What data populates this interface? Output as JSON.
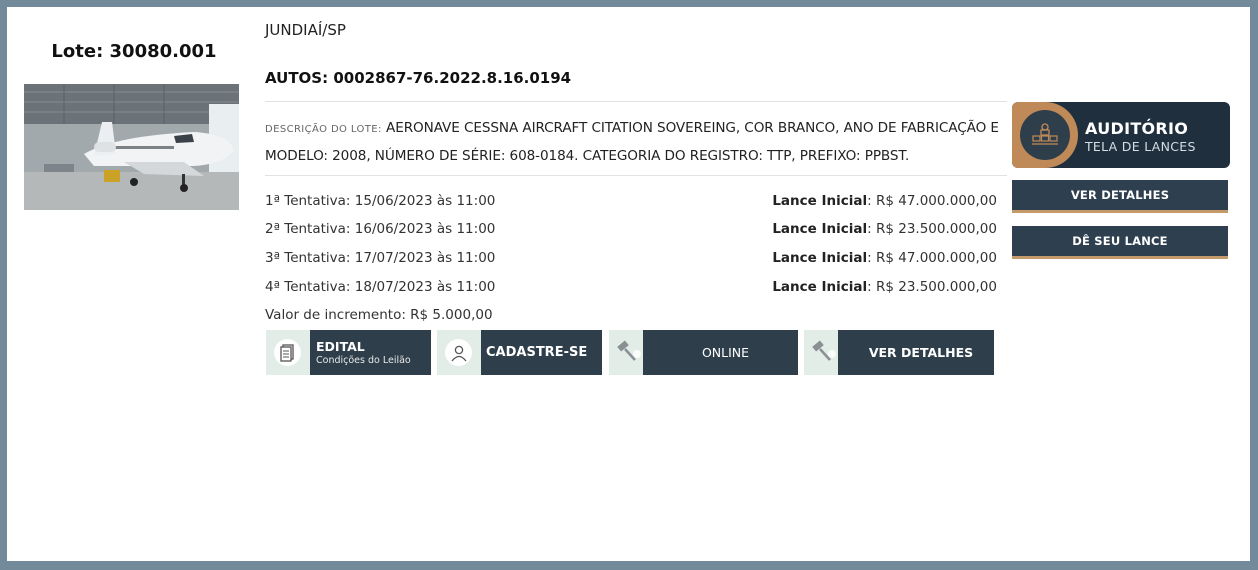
{
  "lot": {
    "title": "Lote: 30080.001"
  },
  "location": "JUNDIAÍ/SP",
  "autos": "AUTOS: 0002867-76.2022.8.16.0194",
  "description": {
    "label": "DESCRIÇÃO DO LOTE:",
    "text": "AERONAVE CESSNA AIRCRAFT CITATION SOVEREING, COR BRANCO, ANO DE FABRICAÇÃO E MODELO: 2008, NÚMERO DE SÉRIE: 608-0184. CATEGORIA DO REGISTRO: TTP, PREFIXO: PPBST."
  },
  "attempts": [
    {
      "label": "1ª Tentativa: 15/06/2023 às 11:00",
      "bid_label": "Lance Inicial",
      "bid_value": ": R$ 47.000.000,00"
    },
    {
      "label": "2ª Tentativa: 16/06/2023 às 11:00",
      "bid_label": "Lance Inicial",
      "bid_value": ": R$ 23.500.000,00"
    },
    {
      "label": "3ª Tentativa: 17/07/2023 às 11:00",
      "bid_label": "Lance Inicial",
      "bid_value": ": R$ 47.000.000,00"
    },
    {
      "label": "4ª Tentativa: 18/07/2023 às 11:00",
      "bid_label": "Lance Inicial",
      "bid_value": ": R$ 23.500.000,00"
    }
  ],
  "increment": "Valor de incremento: R$ 5.000,00",
  "buttons": {
    "edital": {
      "title": "EDITAL",
      "subtitle": "Condições do Leilão",
      "icon": "document-icon"
    },
    "cadastre": {
      "label": "CADASTRE-SE",
      "icon": "user-icon"
    },
    "online": {
      "label": "ONLINE",
      "icon": "gavel-icon"
    },
    "details": {
      "label": "VER DETALHES",
      "icon": "gavel-icon"
    }
  },
  "auditorio": {
    "title": "AUDITÓRIO",
    "subtitle": "TELA DE LANCES",
    "icon": "auditorium-icon"
  },
  "side": {
    "details": "VER DETALHES",
    "bid": "DÊ SEU LANCE"
  },
  "colors": {
    "frame": "#728a9a",
    "button": "#2e3f4b",
    "accent": "#c08a58",
    "icon_bg": "#e2ede7"
  }
}
